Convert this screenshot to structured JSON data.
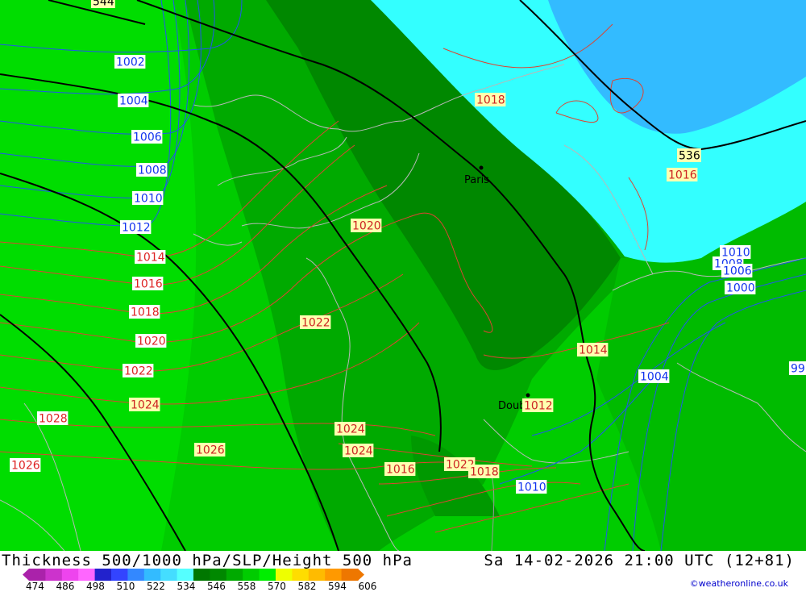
{
  "title_left": "Thickness 500/1000 hPa/SLP/Height 500 hPa",
  "title_right": "Sa 14-02-2026 21:00 UTC (12+81)",
  "credit": "©weatheronline.co.uk",
  "legend": {
    "ticks": [
      "474",
      "486",
      "498",
      "510",
      "522",
      "534",
      "546",
      "558",
      "570",
      "582",
      "594",
      "606"
    ],
    "colors": [
      "#aa22aa",
      "#cc33cc",
      "#ee44ee",
      "#ff66ff",
      "#2222cc",
      "#3344ff",
      "#3388ff",
      "#33bbff",
      "#44ddff",
      "#55ffff",
      "#007700",
      "#008800",
      "#00aa00",
      "#00cc00",
      "#00ee00",
      "#eeff00",
      "#ffdd00",
      "#ffbb00",
      "#ff9900",
      "#ee7700"
    ]
  },
  "cities": [
    {
      "name": "Paris"
    },
    {
      "name": "Doubles"
    }
  ],
  "labels": {
    "height_536": "536",
    "height_top": "544",
    "slp_blue": [
      {
        "text": "1002"
      },
      {
        "text": "1004"
      },
      {
        "text": "1006"
      },
      {
        "text": "1008"
      },
      {
        "text": "1010"
      },
      {
        "text": "1012"
      },
      {
        "text": "1010"
      },
      {
        "text": "1008"
      },
      {
        "text": "1006"
      },
      {
        "text": "1000"
      },
      {
        "text": "1004"
      },
      {
        "text": "1010"
      },
      {
        "text": "99"
      }
    ],
    "slp_red": [
      {
        "text": "1014"
      },
      {
        "text": "1016"
      },
      {
        "text": "1018"
      },
      {
        "text": "1020"
      },
      {
        "text": "1022"
      },
      {
        "text": "1024"
      },
      {
        "text": "1026"
      },
      {
        "text": "1028"
      }
    ],
    "slp_yellow": [
      {
        "text": "1018"
      },
      {
        "text": "1016"
      },
      {
        "text": "1020"
      },
      {
        "text": "1022"
      },
      {
        "text": "1014"
      },
      {
        "text": "1024"
      },
      {
        "text": "1024"
      },
      {
        "text": "1026"
      },
      {
        "text": "1016"
      },
      {
        "text": "1022"
      },
      {
        "text": "1018"
      },
      {
        "text": "1012"
      },
      {
        "text": "1024"
      }
    ]
  }
}
